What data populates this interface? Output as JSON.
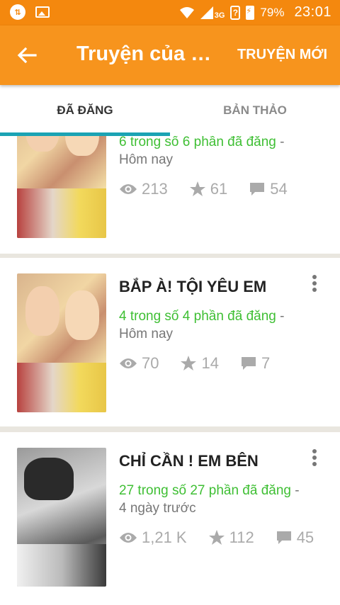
{
  "status_bar": {
    "battery": "79%",
    "time": "23:01",
    "network": "3G"
  },
  "appbar": {
    "title": "Truyện của C...",
    "new_story": "TRUYỆN MỚI"
  },
  "tabs": [
    {
      "label": "ĐÃ ĐĂNG"
    },
    {
      "label": "BẢN THẢO"
    }
  ],
  "stories": [
    {
      "title": "",
      "parts": "6 trong số 6 phần đã đăng",
      "sep": " -",
      "date": "Hôm nay",
      "views": "213",
      "votes": "61",
      "comments": "54"
    },
    {
      "title": "BẮP À! TỘI YÊU EM",
      "parts": "4 trong số 4 phần đã đăng",
      "sep": " -",
      "date": "Hôm nay",
      "views": "70",
      "votes": "14",
      "comments": "7"
    },
    {
      "title": "CHỈ CẦN ! EM BÊN",
      "parts": "27 trong số 27 phần đã đăng",
      "sep": " -",
      "date": "4 ngày trước",
      "views": "1,21 K",
      "votes": "112",
      "comments": "45"
    }
  ]
}
